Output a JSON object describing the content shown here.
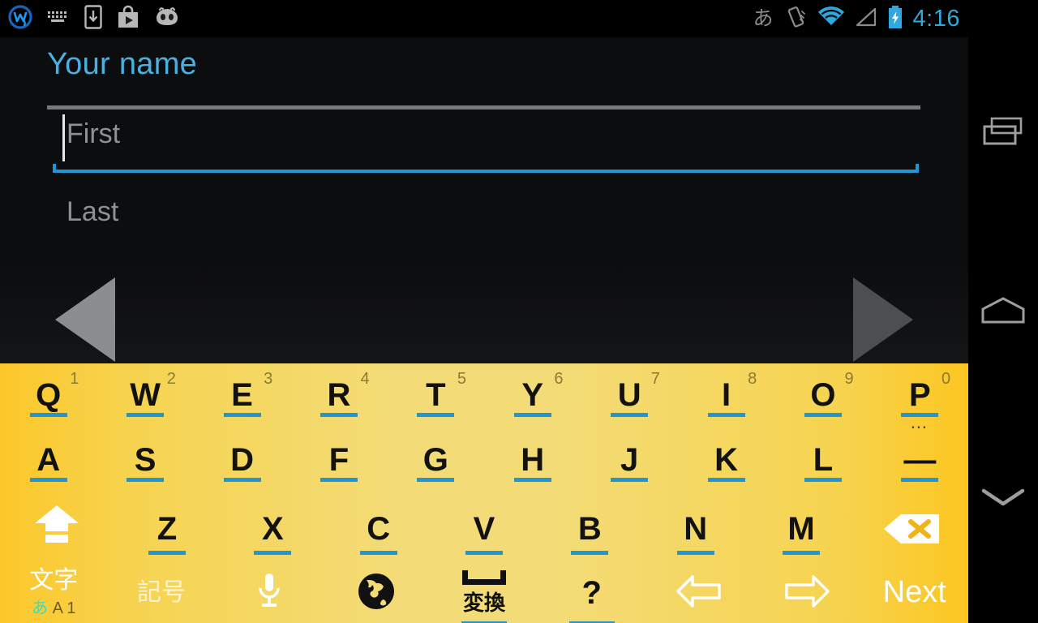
{
  "statusbar": {
    "left_icons": [
      {
        "name": "w-app-icon",
        "label": "W"
      },
      {
        "name": "keyboard-icon",
        "label": "keyboard"
      },
      {
        "name": "app-download-icon",
        "label": "download-to-device"
      },
      {
        "name": "play-store-icon",
        "label": "play-store"
      },
      {
        "name": "android-robot-icon",
        "label": "android"
      }
    ],
    "ime_indicator": "あ",
    "right_icons": [
      {
        "name": "vibrate-icon",
        "label": "vibrate"
      },
      {
        "name": "wifi-icon",
        "label": "wifi"
      },
      {
        "name": "signal-icon",
        "label": "cellular-signal"
      },
      {
        "name": "battery-charging-icon",
        "label": "battery-charging"
      }
    ],
    "clock": "4:16",
    "clock_color": "#2fa8de"
  },
  "content": {
    "title": "Your name",
    "title_color": "#49b0e0",
    "fields": [
      {
        "name": "first",
        "placeholder": "First",
        "value": "",
        "focused": true
      },
      {
        "name": "last",
        "placeholder": "Last",
        "value": "",
        "focused": false
      }
    ],
    "nav_prev_label": "previous",
    "nav_next_label": "next",
    "accent_color": "#2196d4"
  },
  "keyboard": {
    "row1": [
      {
        "letter": "Q",
        "num": "1"
      },
      {
        "letter": "W",
        "num": "2"
      },
      {
        "letter": "E",
        "num": "3"
      },
      {
        "letter": "R",
        "num": "4"
      },
      {
        "letter": "T",
        "num": "5"
      },
      {
        "letter": "Y",
        "num": "6"
      },
      {
        "letter": "U",
        "num": "7"
      },
      {
        "letter": "I",
        "num": "8"
      },
      {
        "letter": "O",
        "num": "9"
      },
      {
        "letter": "P",
        "num": "0",
        "sub": "…"
      }
    ],
    "row2": [
      {
        "letter": "A"
      },
      {
        "letter": "S"
      },
      {
        "letter": "D"
      },
      {
        "letter": "F"
      },
      {
        "letter": "G"
      },
      {
        "letter": "H"
      },
      {
        "letter": "J"
      },
      {
        "letter": "K"
      },
      {
        "letter": "L"
      },
      {
        "letter": "—"
      }
    ],
    "row3": [
      {
        "name": "shift-key",
        "icon": "shift-arrow-icon"
      },
      {
        "letter": "Z"
      },
      {
        "letter": "X"
      },
      {
        "letter": "C"
      },
      {
        "letter": "V"
      },
      {
        "letter": "B"
      },
      {
        "letter": "N"
      },
      {
        "letter": "M"
      },
      {
        "name": "backspace-key",
        "icon": "backspace-icon"
      }
    ],
    "row4": {
      "mode_key": {
        "name": "character-mode-key",
        "label": "文字",
        "sub_jp": "あ",
        "sub_en": "A 1"
      },
      "symbol_key": {
        "name": "symbol-key",
        "label": "記号"
      },
      "mic_key": {
        "name": "voice-input-key",
        "icon": "microphone-icon"
      },
      "globe_key": {
        "name": "language-switch-key",
        "icon": "globe-icon"
      },
      "space_key": {
        "name": "space-key",
        "label": "変換"
      },
      "question_key": {
        "name": "question-mark-key",
        "label": "?"
      },
      "left_key": {
        "name": "cursor-left-key",
        "icon": "arrow-left-icon"
      },
      "right_key": {
        "name": "cursor-right-key",
        "icon": "arrow-right-icon"
      },
      "enter_key": {
        "name": "next-key",
        "label": "Next"
      }
    },
    "bg_left_color": "#fcc72a",
    "bg_mid_color": "#f3dc78",
    "underline_color": "#2196d4"
  },
  "navbar": {
    "recents_label": "recents",
    "home_label": "home",
    "back_label": "hide-keyboard"
  }
}
